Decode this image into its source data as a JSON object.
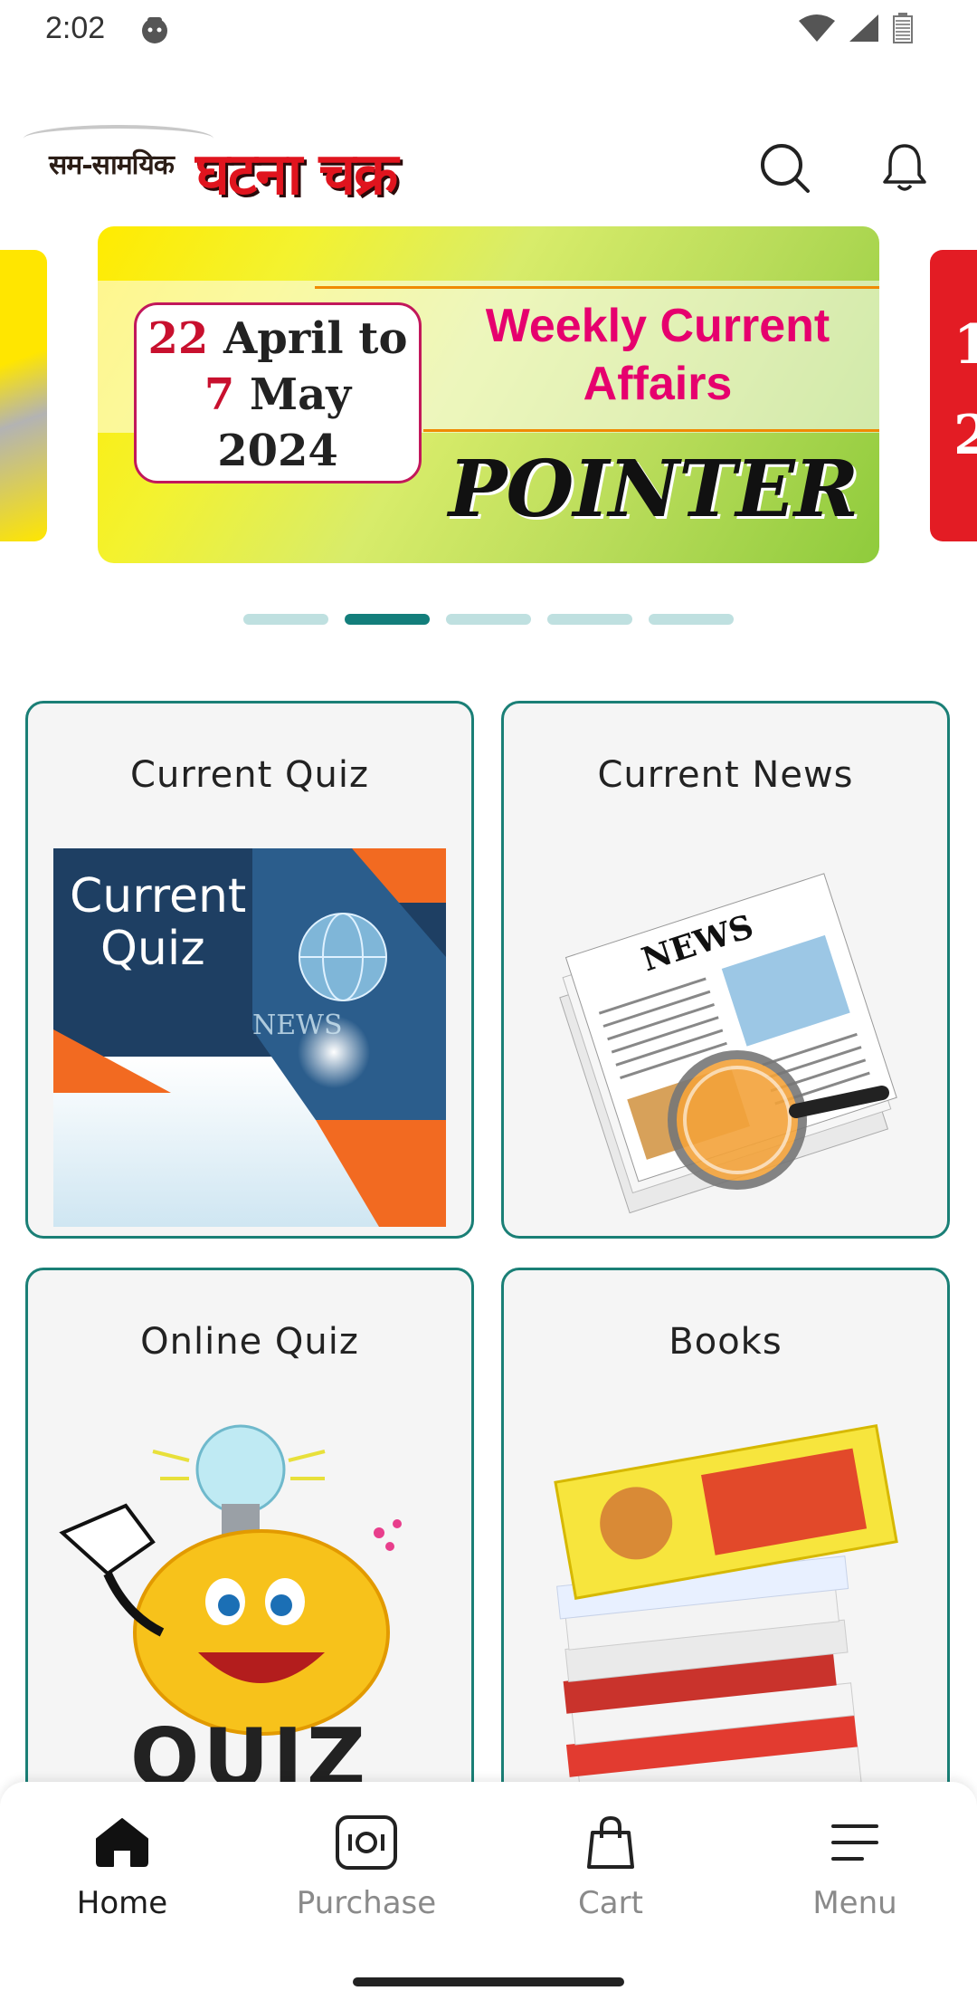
{
  "status_bar": {
    "time": "2:02"
  },
  "header": {
    "logo_small_text": "सम-सामयिक",
    "logo_big_text": "घटना चक्र",
    "search_icon": "search-icon",
    "notification_icon": "bell-icon"
  },
  "carousel": {
    "slide": {
      "date_line1_num": "22",
      "date_line1_rest": " April to",
      "date_line2_num": "7",
      "date_line2_rest": " May",
      "date_line3": "2024",
      "title": "Weekly Current Affairs",
      "brand": "POINTER"
    },
    "dots": [
      {
        "active": false
      },
      {
        "active": true
      },
      {
        "active": false
      },
      {
        "active": false
      },
      {
        "active": false
      }
    ],
    "active_index": 1,
    "slide_count": 5
  },
  "cards": [
    {
      "title": "Current Quiz",
      "image_label_line1": "Current",
      "image_label_line2": "Quiz"
    },
    {
      "title": "Current News",
      "image_label": "NEWS"
    },
    {
      "title": "Online Quiz",
      "image_label": "QUIZ"
    },
    {
      "title": "Books"
    }
  ],
  "bottom_nav": {
    "items": [
      {
        "label": "Home",
        "icon": "home-icon",
        "active": true
      },
      {
        "label": "Purchase",
        "icon": "purchase-icon",
        "active": false
      },
      {
        "label": "Cart",
        "icon": "cart-icon",
        "active": false
      },
      {
        "label": "Menu",
        "icon": "menu-icon",
        "active": false
      }
    ]
  },
  "colors": {
    "accent": "#137e7b",
    "card_border": "#1a7f76",
    "logo_red": "#e0141e",
    "banner_pink": "#e6006e"
  }
}
